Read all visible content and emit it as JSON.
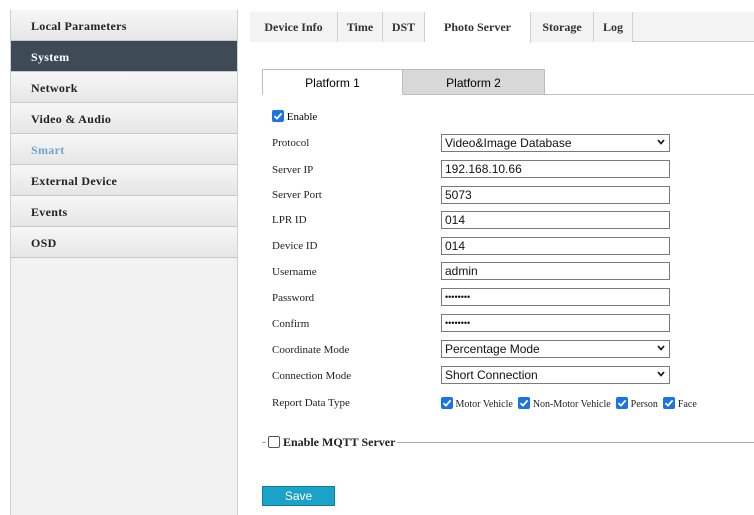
{
  "sidebar": {
    "items": [
      {
        "label": "Local Parameters",
        "state": "normal"
      },
      {
        "label": "System",
        "state": "active"
      },
      {
        "label": "Network",
        "state": "normal"
      },
      {
        "label": "Video & Audio",
        "state": "normal"
      },
      {
        "label": "Smart",
        "state": "dim"
      },
      {
        "label": "External Device",
        "state": "normal"
      },
      {
        "label": "Events",
        "state": "normal"
      },
      {
        "label": "OSD",
        "state": "normal"
      }
    ]
  },
  "tabs": [
    "Device Info",
    "Time",
    "DST",
    "Photo Server",
    "Storage",
    "Log"
  ],
  "active_tab": "Photo Server",
  "platform_tabs": [
    "Platform 1",
    "Platform 2"
  ],
  "form": {
    "enable_label": "Enable",
    "enable_checked": true,
    "protocol_label": "Protocol",
    "protocol_value": "Video&Image Database",
    "server_ip_label": "Server IP",
    "server_ip_value": "192.168.10.66",
    "server_port_label": "Server Port",
    "server_port_value": "5073",
    "lpr_id_label": "LPR ID",
    "lpr_id_value": "014",
    "device_id_label": "Device ID",
    "device_id_value": "014",
    "username_label": "Username",
    "username_value": "admin",
    "password_label": "Password",
    "password_value": "••••••••",
    "confirm_label": "Confirm",
    "confirm_value": "••••••••",
    "coordinate_mode_label": "Coordinate Mode",
    "coordinate_mode_value": "Percentage Mode",
    "connection_mode_label": "Connection Mode",
    "connection_mode_value": "Short Connection",
    "report_data_type_label": "Report Data Type",
    "report_types": [
      {
        "label": "Motor Vehicle",
        "checked": true
      },
      {
        "label": "Non-Motor Vehicle",
        "checked": true
      },
      {
        "label": "Person",
        "checked": true
      },
      {
        "label": "Face",
        "checked": true
      }
    ]
  },
  "mqtt": {
    "label": "Enable MQTT Server",
    "checked": false
  },
  "save_label": "Save",
  "colors": {
    "sidebar_active": "#3f4a57",
    "accent_blue": "#1a73e8",
    "save_button": "#1aa2c9",
    "smart_text": "#6fa3c8"
  },
  "icons": {
    "checkbox_checked": "checkmark-icon",
    "dropdown": "chevron-down-icon"
  }
}
